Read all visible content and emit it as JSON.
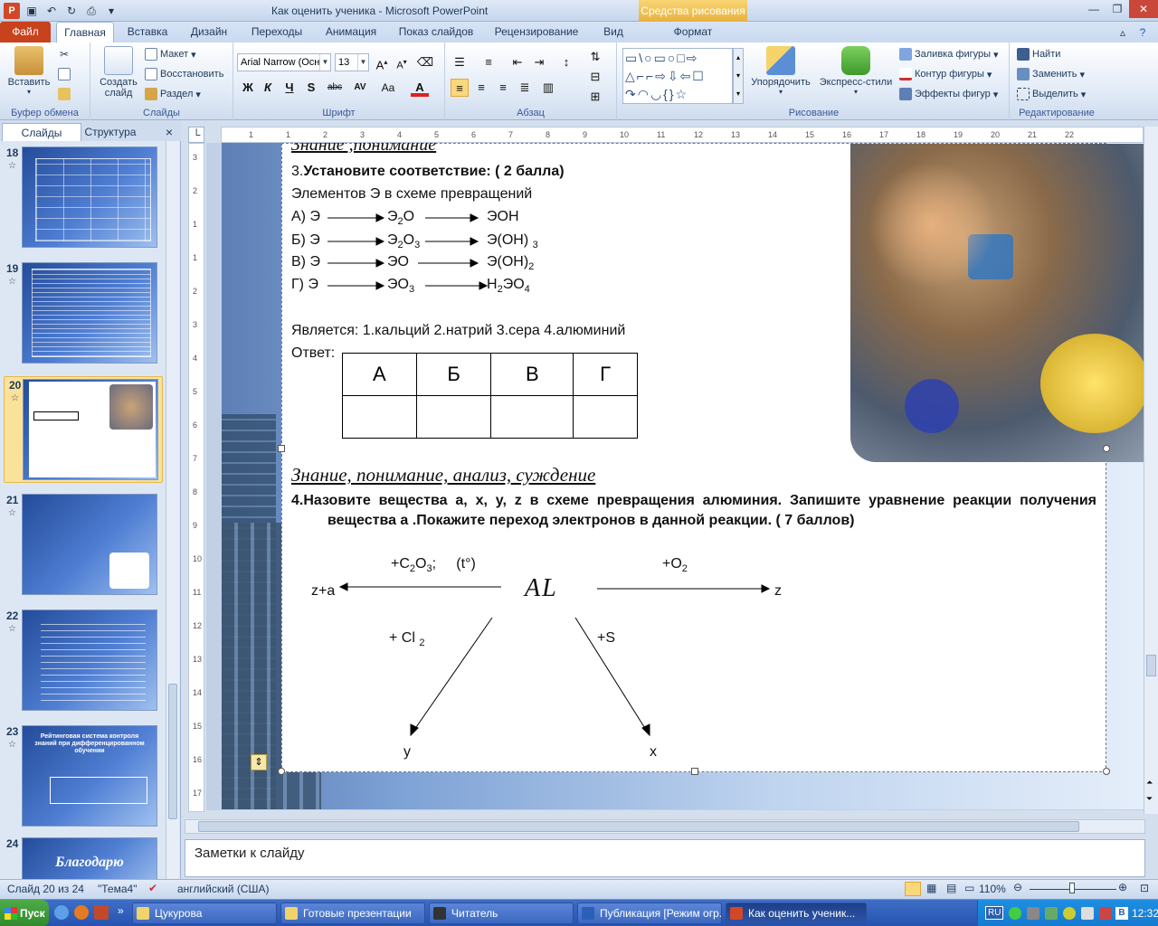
{
  "window": {
    "title": "Как оценить ученика  -  Microsoft PowerPoint",
    "context_tab": "Средства рисования",
    "app_logo": "P"
  },
  "tabs": [
    "Файл",
    "Главная",
    "Вставка",
    "Дизайн",
    "Переходы",
    "Анимация",
    "Показ слайдов",
    "Рецензирование",
    "Вид",
    "Формат"
  ],
  "ribbon": {
    "clipboard": {
      "paste": "Вставить",
      "label": "Буфер обмена"
    },
    "slides": {
      "new_slide_1": "Создать",
      "new_slide_2": "слайд",
      "layout": "Макет",
      "reset": "Восстановить",
      "section": "Раздел",
      "label": "Слайды"
    },
    "font": {
      "name": "Arial Narrow (Осн",
      "size": "13",
      "bold": "Ж",
      "italic": "К",
      "underline": "Ч",
      "shadow": "S",
      "strike": "abc",
      "spacing": "AV",
      "case": "Aa",
      "color": "A",
      "label": "Шрифт"
    },
    "paragraph": {
      "label": "Абзац"
    },
    "drawing": {
      "arrange": "Упорядочить",
      "quick_styles": "Экспресс-стили",
      "fill": "Заливка фигуры",
      "outline": "Контур фигуры",
      "effects": "Эффекты фигур",
      "label": "Рисование"
    },
    "editing": {
      "find": "Найти",
      "replace": "Заменить",
      "select": "Выделить",
      "label": "Редактирование"
    }
  },
  "left_panel": {
    "tabs": [
      "Слайды",
      "Структура"
    ],
    "close": "×",
    "thumbs": [
      {
        "num": "18",
        "title": ""
      },
      {
        "num": "19",
        "title": ""
      },
      {
        "num": "20",
        "title": ""
      },
      {
        "num": "21",
        "title": ""
      },
      {
        "num": "22",
        "title": ""
      },
      {
        "num": "23",
        "title": "Рейтинговая система контроля знаний при дифференцированном обучении"
      },
      {
        "num": "24",
        "title": "Благодарю"
      }
    ],
    "star": "☆"
  },
  "ruler": {
    "h": [
      "1",
      "1",
      "2",
      "3",
      "4",
      "5",
      "6",
      "7",
      "8",
      "9",
      "10",
      "11",
      "12",
      "13",
      "14",
      "15",
      "16",
      "17",
      "18",
      "19",
      "20",
      "21",
      "22"
    ],
    "v": [
      "3",
      "2",
      "1",
      "1",
      "2",
      "3",
      "4",
      "5",
      "6",
      "7",
      "8",
      "9",
      "10",
      "11",
      "12",
      "13",
      "14",
      "15",
      "16",
      "17"
    ]
  },
  "slide": {
    "top_heading": "Знание ,понимание",
    "q3_num": "3.",
    "q3_text": "Установите соответствие:     ( 2 балла)",
    "q3_sub": "Элементов Э в схеме превращений",
    "rows": [
      {
        "l": "А) Э",
        "m": "Э",
        "m_sub": "2",
        "m2": "О",
        "r": "ЭОН",
        "r_sub": ""
      },
      {
        "l": "Б) Э",
        "m": "Э",
        "m_sub": "2",
        "m2": "О",
        "m_sub2": "3",
        "r": "Э(ОН)",
        "r_sub": "3"
      },
      {
        "l": "В) Э",
        "m": "ЭО",
        "m_sub": "",
        "m2": "",
        "r": "Э(ОН)",
        "r_sub": "2"
      },
      {
        "l": "Г) Э",
        "m": "ЭО",
        "m_sub": "3",
        "m2": "",
        "r": "Н",
        "r_sub": "2",
        "r2": "ЭО",
        "r_sub2": "4"
      }
    ],
    "is": "Является:   1.кальций  2.натрий  3.сера   4.алюминий",
    "answer": "Ответ:",
    "table_head": [
      "А",
      "Б",
      "В",
      "Г"
    ],
    "heading2": "Знание, понимание, анализ, суждение",
    "q4_a": "4.Назовите вещества а, х, у, z в схеме превращения алюминия. Запишите уравнение реакции получения",
    "q4_b": "вещества а .Покажите переход электронов в данной реакции.   ( 7 баллов)",
    "al": "AL",
    "left_label_a": "+C",
    "left_label_sub1": "2",
    "left_label_b": "O",
    "left_label_sub2": "3",
    "left_label_c": ";",
    "left_label_t": "(t°)",
    "right_label": "+O",
    "right_sub": "2",
    "za": "z+a",
    "z": "z",
    "cl": "+ Cl",
    "cl_sub": "2",
    "s": "+S",
    "y": "y",
    "x": "x"
  },
  "notes": {
    "placeholder": "Заметки к слайду"
  },
  "status": {
    "slide": "Слайд 20 из 24",
    "theme": "\"Тема4\"",
    "lang": "английский (США)",
    "zoom": "110%"
  },
  "taskbar": {
    "start": "Пуск",
    "items": [
      "Цукурова",
      "Готовые презентации",
      "Читатель",
      "Публикация [Режим огр...",
      "Как оценить ученик..."
    ],
    "lang": "RU",
    "time": "12:32"
  },
  "colors": {
    "accent": "#c8421e",
    "context": "#e8b23e",
    "ribbon": "#dfe9f6"
  }
}
